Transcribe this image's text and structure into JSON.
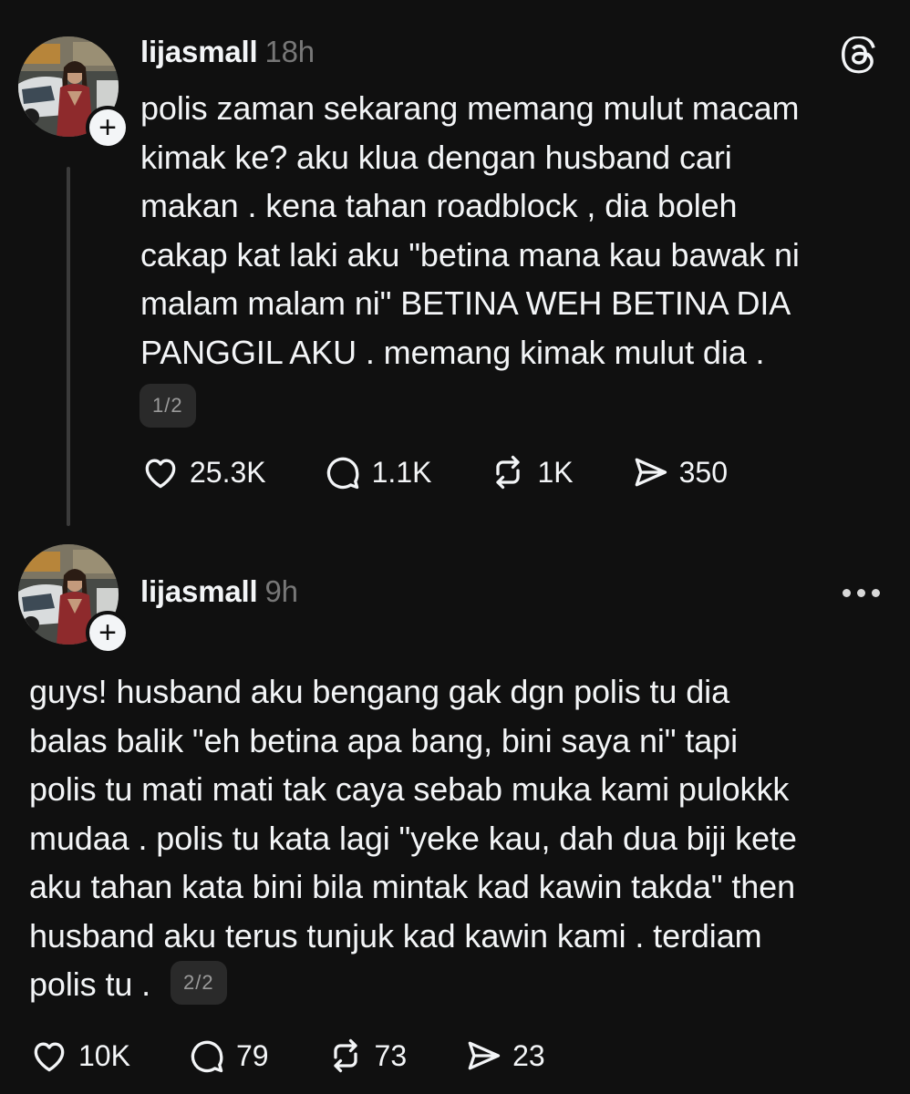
{
  "app": {
    "logo_glyph": "@",
    "accent_text": "#f3f5f7",
    "background": "#101010",
    "muted": "#777777"
  },
  "posts": [
    {
      "username": "lijasmall",
      "time": "18h",
      "follow_icon": "+",
      "top_right_icon": "threads-logo-icon",
      "text_lines": [
        "polis zaman sekarang memang mulut macam",
        "kimak ke? aku klua dengan husband cari",
        "makan . kena tahan roadblock , dia boleh",
        "cakap kat laki aku \"betina mana kau bawak ni",
        "malam malam ni\" BETINA WEH BETINA DIA",
        "PANGGIL AKU . memang kimak mulut dia ."
      ],
      "page": "1/2",
      "likes": "25.3K",
      "replies": "1.1K",
      "reposts": "1K",
      "shares": "350"
    },
    {
      "username": "lijasmall",
      "time": "9h",
      "follow_icon": "+",
      "top_right_icon": "more-icon",
      "text_lines": [
        "guys! husband aku bengang gak dgn polis tu dia",
        "balas balik \"eh betina apa bang, bini saya ni\" tapi",
        "polis tu mati mati tak caya sebab muka kami pulokkk",
        "mudaa . polis tu kata lagi \"yeke kau, dah dua biji kete",
        "aku tahan kata bini bila mintak kad kawin takda\" then",
        "husband aku terus tunjuk kad kawin kami . terdiam",
        "polis tu ."
      ],
      "page": "2/2",
      "likes": "10K",
      "replies": "79",
      "reposts": "73",
      "shares": "23"
    }
  ]
}
